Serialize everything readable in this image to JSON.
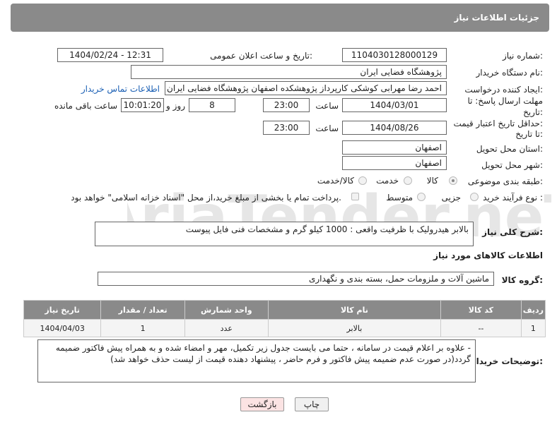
{
  "header": {
    "title": "جزئیات اطلاعات نیاز"
  },
  "fields": {
    "need_number_label": "شماره نیاز:",
    "need_number": "1104030128000129",
    "announce_label": "تاریخ و ساعت اعلان عمومی:",
    "announce_value": "1404/02/24 - 12:31",
    "buyer_org_label": "نام دستگاه خریدار:",
    "buyer_org": "پژوهشگاه فضایی ایران",
    "creator_label": "ایجاد کننده درخواست:",
    "creator": "احمد رضا مهرابی کوشکی کارپرداز پژوهشکده اصفهان پژوهشگاه فضایی ایران",
    "contact_link": "اطلاعات تماس خریدار",
    "deadline_label_1": "مهلت ارسال پاسخ: تا",
    "deadline_label_2": "تاریخ:",
    "deadline_date": "1404/03/01",
    "time_label": "ساعت",
    "deadline_time": "23:00",
    "days_value": "8",
    "days_label": "روز و",
    "remaining_time": "10:01:20",
    "remaining_label": "ساعت باقی مانده",
    "validity_label_1": "حداقل تاریخ اعتبار قیمت:",
    "validity_label_2": "تا تاریخ:",
    "validity_date": "1404/08/26",
    "validity_time": "23:00",
    "province_label": "استان محل تحویل:",
    "province": "اصفهان",
    "city_label": "شهر محل تحویل:",
    "city": "اصفهان",
    "category_label": "طبقه بندی موضوعی:",
    "category_options": [
      "کالا",
      "خدمت",
      "کالا/خدمت"
    ],
    "category_selected": "کالا",
    "process_label": "نوع فرآیند خرید :",
    "process_options": [
      "جزیی",
      "متوسط"
    ],
    "process_note": "پرداخت تمام یا بخشی از مبلغ خرید،از محل \"اسناد خزانه اسلامی\" خواهد بود."
  },
  "description": {
    "label": "شرح کلی نیاز:",
    "text": "بالابر هیدرولیک با ظرفیت واقعی : 1000 کیلو گرم و مشخصات فنی فایل پیوست"
  },
  "goods": {
    "section_title": "اطلاعات کالاهای مورد نیاز",
    "group_label": "گروه کالا:",
    "group_value": "ماشین آلات و ملزومات حمل، بسته بندی و نگهداری"
  },
  "table": {
    "headers": [
      "ردیف",
      "کد کالا",
      "نام کالا",
      "واحد شمارش",
      "تعداد / مقدار",
      "تاریخ نیاز"
    ],
    "rows": [
      [
        "1",
        "--",
        "بالابر",
        "عدد",
        "1",
        "1404/04/03"
      ]
    ]
  },
  "buyer_notes": {
    "label": "توضیحات خریدار:",
    "text": "-      علاوه بر اعلام قیمت در سامانه ، حتما می بایست جدول زیر تکمیل، مهر و امضاء شده و به همراه پیش فاکتور ضمیمه گردد(در صورت عدم ضمیمه پیش فاکتور و فرم حاضر ، پیشنهاد دهنده قیمت از لیست حذف خواهد شد)"
  },
  "buttons": {
    "print": "چاپ",
    "back": "بازگشت"
  },
  "watermark": {
    "text": "AriaTender.neT"
  },
  "colors": {
    "header_bg": "#8a8a8a",
    "link": "#1a5fb4",
    "back_button_bg": "#fbe3e3"
  }
}
